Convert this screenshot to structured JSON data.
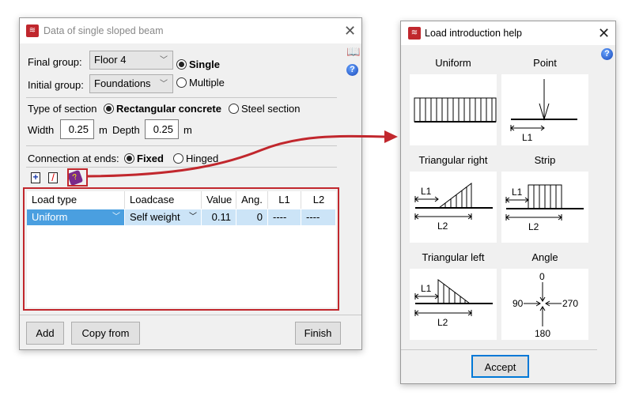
{
  "beam_dialog": {
    "title": "Data of single sloped beam",
    "final_group_label": "Final group:",
    "final_group_value": "Floor 4",
    "initial_group_label": "Initial group:",
    "initial_group_value": "Foundations",
    "single_label": "Single",
    "multiple_label": "Multiple",
    "group_mode": "Single",
    "section_type_label": "Type of section",
    "rect_label": "Rectangular concrete",
    "steel_label": "Steel section",
    "section_type": "Rectangular concrete",
    "width_label": "Width",
    "width_value": "0.25",
    "depth_label": "Depth",
    "depth_value": "0.25",
    "unit": "m",
    "connection_label": "Connection at ends:",
    "fixed_label": "Fixed",
    "hinged_label": "Hinged",
    "connection": "Fixed",
    "table": {
      "headers": [
        "Load type",
        "Loadcase",
        "Value",
        "Ang.",
        "L1",
        "L2"
      ],
      "rows": [
        {
          "load_type": "Uniform",
          "loadcase": "Self weight",
          "value": "0.11",
          "angle": "0",
          "l1": "----",
          "l2": "----"
        }
      ]
    },
    "buttons": {
      "add": "Add",
      "copy_from": "Copy from",
      "finish": "Finish"
    }
  },
  "help_dialog": {
    "title": "Load introduction help",
    "panels": [
      {
        "title": "Uniform"
      },
      {
        "title": "Point",
        "l1": "L1"
      },
      {
        "title": "Triangular right",
        "l1": "L1",
        "l2": "L2"
      },
      {
        "title": "Strip",
        "l1": "L1",
        "l2": "L2"
      },
      {
        "title": "Triangular left",
        "l1": "L1",
        "l2": "L2"
      },
      {
        "title": "Angle",
        "a0": "0",
        "a90": "90",
        "a270": "270",
        "a180": "180"
      }
    ],
    "accept": "Accept"
  },
  "colors": {
    "highlight": "#c1272d",
    "selection": "#4a9fe0"
  }
}
